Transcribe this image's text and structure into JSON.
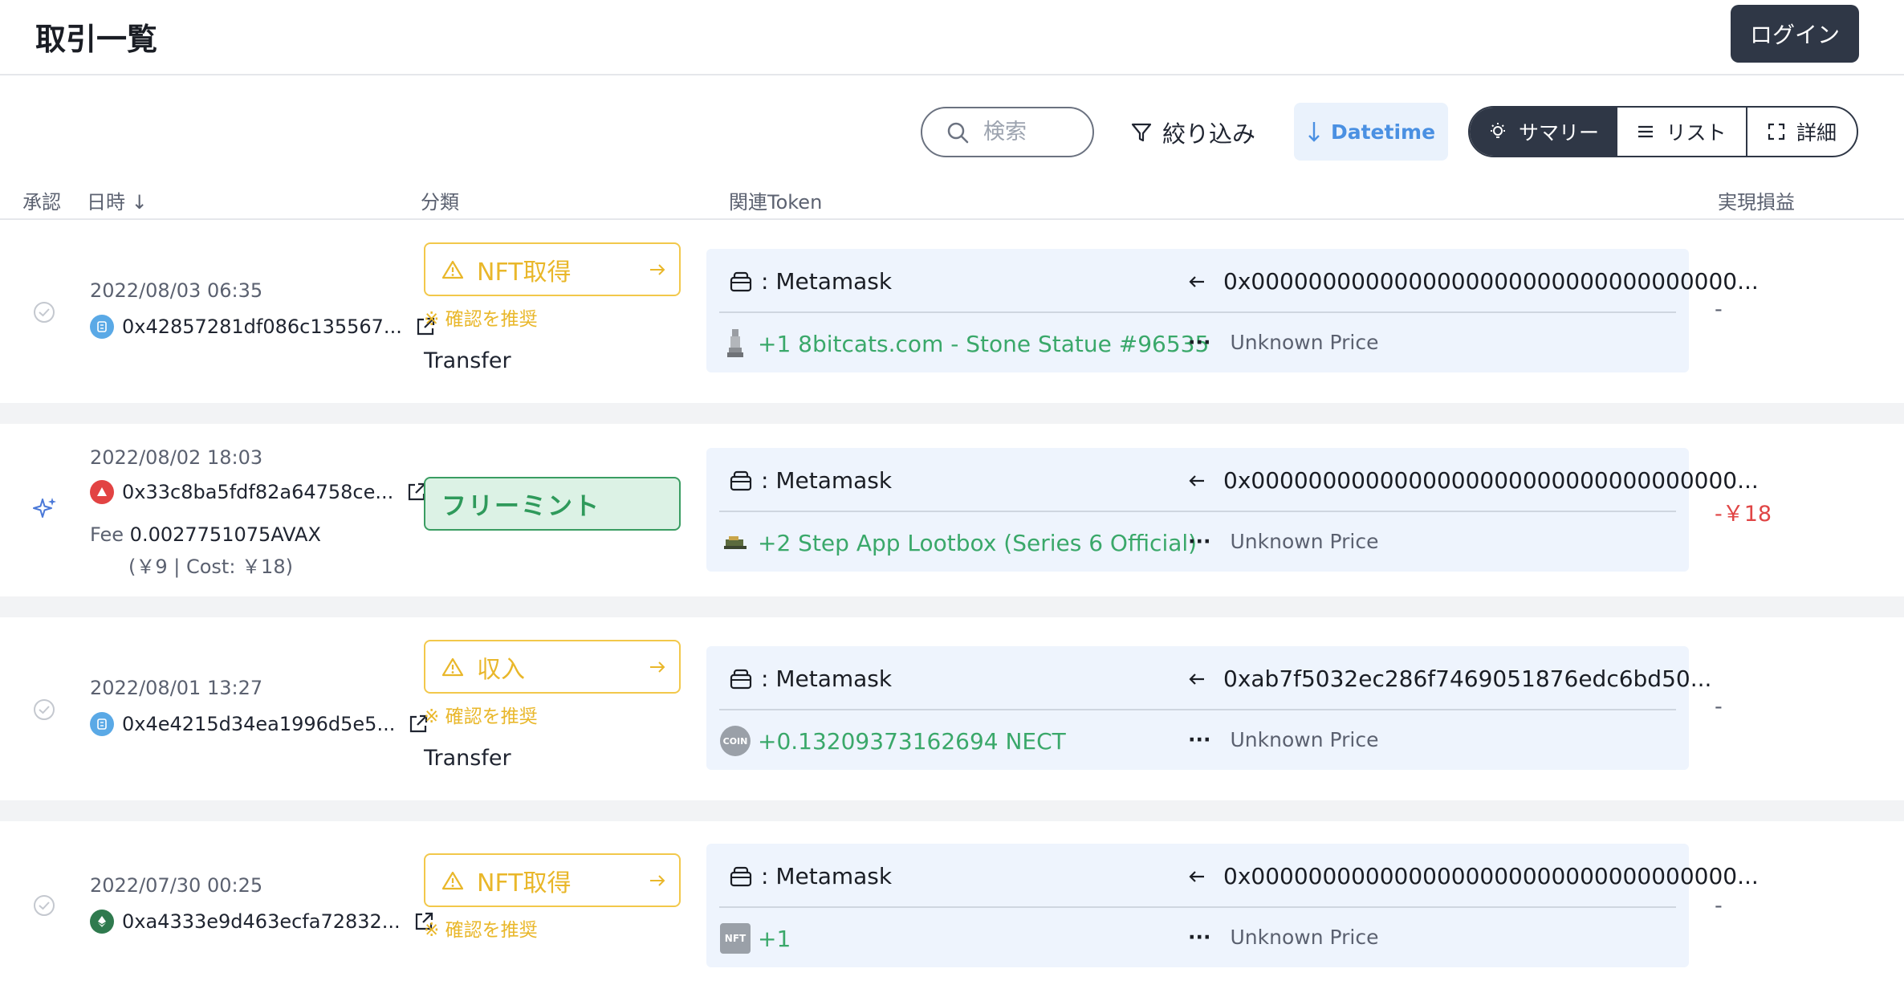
{
  "header": {
    "title": "取引一覧",
    "login_label": "ログイン"
  },
  "toolbar": {
    "search_placeholder": "検索",
    "filter_label": "絞り込み",
    "sort_label": "Datetime",
    "views": {
      "summary": "サマリー",
      "list": "リスト",
      "detail": "詳細"
    },
    "active_view": "summary"
  },
  "columns": {
    "approve": "承認",
    "datetime": "日時 ↓",
    "category": "分類",
    "token": "関連Token",
    "pl": "実現損益"
  },
  "rows": [
    {
      "datetime": "2022/08/03 06:35",
      "hash": "0x42857281df086c135567...",
      "chain_icon": "polygon-chain-icon",
      "category": "NFT取得",
      "category_note": "※ 確認を推奨",
      "sub": "Transfer",
      "wallet": ": Metamask",
      "address": "0x0000000000000000000000000000000000...",
      "token": "+1 8bitcats.com - Stone Statue #96535",
      "price": "Unknown Price",
      "pl": "-"
    },
    {
      "datetime": "2022/08/02 18:03",
      "hash": "0x33c8ba5fdf82a64758ce...",
      "chain_icon": "avalanche-chain-icon",
      "fee_label": "Fee",
      "fee_value": "0.0027751075AVAX",
      "fee_sub": "(￥9 | Cost: ￥18)",
      "category": "フリーミント",
      "wallet": ": Metamask",
      "address": "0x0000000000000000000000000000000000...",
      "token": "+2 Step App Lootbox (Series 6 Official)",
      "price": "Unknown Price",
      "pl": "-￥18"
    },
    {
      "datetime": "2022/08/01 13:27",
      "hash": "0x4e4215d34ea1996d5e5...",
      "chain_icon": "polygon-chain-icon",
      "category": "収入",
      "category_note": "※ 確認を推奨",
      "sub": "Transfer",
      "wallet": ": Metamask",
      "address": "0xab7f5032ec286f7469051876edc6bd50...",
      "token": "+0.13209373162694 NECT",
      "token_badge": "COIN",
      "price": "Unknown Price",
      "pl": "-"
    },
    {
      "datetime": "2022/07/30 00:25",
      "hash": "0xa4333e9d463ecfa72832...",
      "chain_icon": "ethereum-chain-icon",
      "category": "NFT取得",
      "category_note": "※ 確認を推奨",
      "wallet": ": Metamask",
      "address": "0x0000000000000000000000000000000000...",
      "token": "+1",
      "token_badge": "NFT",
      "price": "Unknown Price",
      "pl": "-"
    }
  ],
  "colors": {
    "accent": "#4a90e2",
    "warning": "#e9b72a",
    "positive": "#3aa86a",
    "negative": "#e04545",
    "dark": "#2f3746"
  }
}
